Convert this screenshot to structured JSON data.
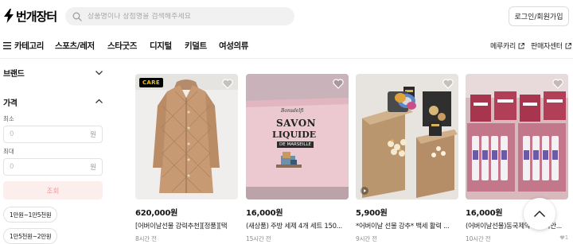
{
  "header": {
    "logo_text": "번개장터",
    "search_placeholder": "상품명이나 상점명을 검색해주세요",
    "login_label": "로그인/회원가입"
  },
  "nav": {
    "category_label": "카테고리",
    "tabs": [
      "스포츠/레저",
      "스타굿즈",
      "디지털",
      "키덜트",
      "여성의류"
    ],
    "external_links": [
      "메루카리",
      "판매자센터"
    ]
  },
  "sidebar": {
    "brand_title": "브랜드",
    "price_title": "가격",
    "min_label": "최소",
    "max_label": "최대",
    "min_placeholder": "0",
    "max_placeholder": "0",
    "unit": "원",
    "apply_label": "조회",
    "chips": [
      "1만원~1만5천원",
      "1만5천원~2만원"
    ]
  },
  "products": [
    {
      "price": "620,000원",
      "title": "[어버이날선물 강력추천][정품][택",
      "time": "8시간 전",
      "badge": "CARE"
    },
    {
      "price": "16,000원",
      "title": "(새상품) 주방 세제 4개 세트 150...",
      "time": "15시간 전",
      "box_text_1": "Bonsdelfl",
      "box_text_2": "SAVON",
      "box_text_3": "LIQUIDE",
      "box_text_4": "DE MARSEILLE"
    },
    {
      "price": "5,900원",
      "title": "*어버이날 선물 강추* 백세 활력 ...",
      "time": "9시간 전"
    },
    {
      "price": "16,000원",
      "title": "(어버이날선물)동국제약 센텔리안...",
      "time": "10시간 전",
      "favorites": "1"
    }
  ],
  "colors": {
    "accent_red": "#d80c18",
    "apply_bg": "#fdeeee",
    "apply_text": "#ee9b9b"
  },
  "icons": {
    "logo": "lightning-bolt-icon",
    "search": "search-icon",
    "menu": "hamburger-menu-icon",
    "external": "external-link-icon",
    "chevron": "chevron-icon",
    "heart": "heart-icon",
    "play": "play-icon",
    "scroll_top": "chevron-up-icon"
  }
}
